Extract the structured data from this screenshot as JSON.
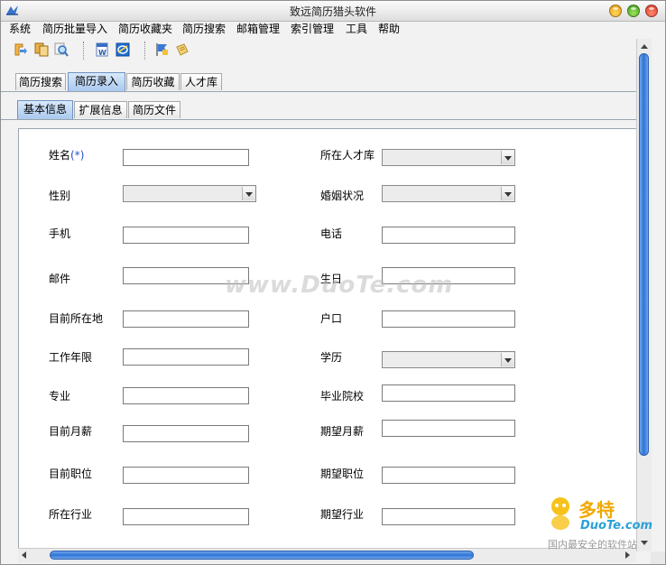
{
  "window": {
    "title": "致远简历猎头软件"
  },
  "menu": [
    "系统",
    "简历批量导入",
    "简历收藏夹",
    "简历搜索",
    "邮箱管理",
    "索引管理",
    "工具",
    "帮助"
  ],
  "toolbar": {
    "icons": [
      "import-icon",
      "copy-icon",
      "search-icon",
      "word-icon",
      "ie-icon",
      "flag-icon",
      "note-icon"
    ]
  },
  "main_tabs": [
    "简历搜索",
    "简历录入",
    "简历收藏",
    "人才库"
  ],
  "main_tab_active": "简历录入",
  "sub_tabs": [
    "基本信息",
    "扩展信息",
    "简历文件"
  ],
  "sub_tab_active": "基本信息",
  "form": {
    "left": [
      {
        "label": "姓名",
        "required_mark": "(*)",
        "type": "text",
        "value": ""
      },
      {
        "label": "性别",
        "type": "select",
        "value": ""
      },
      {
        "label": "手机",
        "type": "text",
        "value": ""
      },
      {
        "label": "邮件",
        "type": "text",
        "value": ""
      },
      {
        "label": "目前所在地",
        "type": "text",
        "value": ""
      },
      {
        "label": "工作年限",
        "type": "text",
        "value": ""
      },
      {
        "label": "专业",
        "type": "text",
        "value": ""
      },
      {
        "label": "目前月薪",
        "type": "text",
        "value": ""
      },
      {
        "label": "目前职位",
        "type": "text",
        "value": ""
      },
      {
        "label": "所在行业",
        "type": "text",
        "value": ""
      }
    ],
    "right": [
      {
        "label": "所在人才库",
        "type": "select",
        "value": ""
      },
      {
        "label": "婚姻状况",
        "type": "select",
        "value": ""
      },
      {
        "label": "电话",
        "type": "text",
        "value": ""
      },
      {
        "label": "生日",
        "type": "text",
        "value": ""
      },
      {
        "label": "户口",
        "type": "text",
        "value": ""
      },
      {
        "label": "学历",
        "type": "select",
        "value": ""
      },
      {
        "label": "毕业院校",
        "type": "text",
        "value": ""
      },
      {
        "label": "期望月薪",
        "type": "text",
        "value": ""
      },
      {
        "label": "期望职位",
        "type": "text",
        "value": ""
      },
      {
        "label": "期望行业",
        "type": "text",
        "value": ""
      }
    ]
  },
  "watermark": {
    "text": "www.DuoTe.com"
  },
  "logo": {
    "name": "多特",
    "sub": "DuoTe.com",
    "slogan": "国内最安全的软件站"
  },
  "colors": {
    "accent": "#2f74d6",
    "required": "#2255cc"
  }
}
